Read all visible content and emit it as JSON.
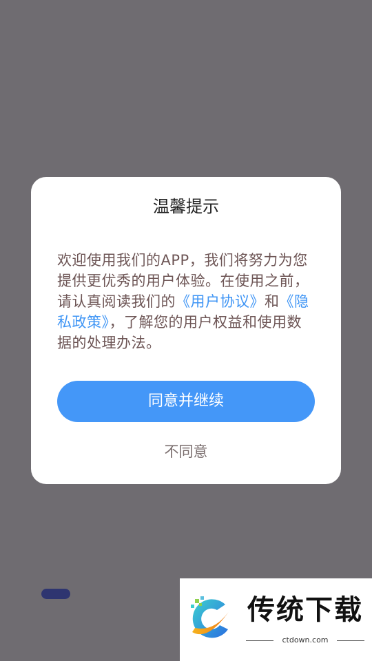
{
  "dialog": {
    "title": "温馨提示",
    "body": {
      "text_1": "欢迎使用我们的APP，我们将努力为您提供更优秀的用户体验。在使用之前，请认真阅读我们的",
      "link_user_agreement": "《用户协议》",
      "text_2": "和",
      "link_privacy_policy": "《隐私政策》",
      "text_3": "，了解您的用户权益和使用数据的处理办法。"
    },
    "agree_label": "同意并继续",
    "disagree_label": "不同意"
  },
  "watermark": {
    "title": "传统下载",
    "subtitle": "ctdown.com"
  },
  "colors": {
    "backdrop": "#6f6c71",
    "accent": "#4497f8",
    "link": "#3f95f5",
    "body_text": "#6d5555"
  }
}
